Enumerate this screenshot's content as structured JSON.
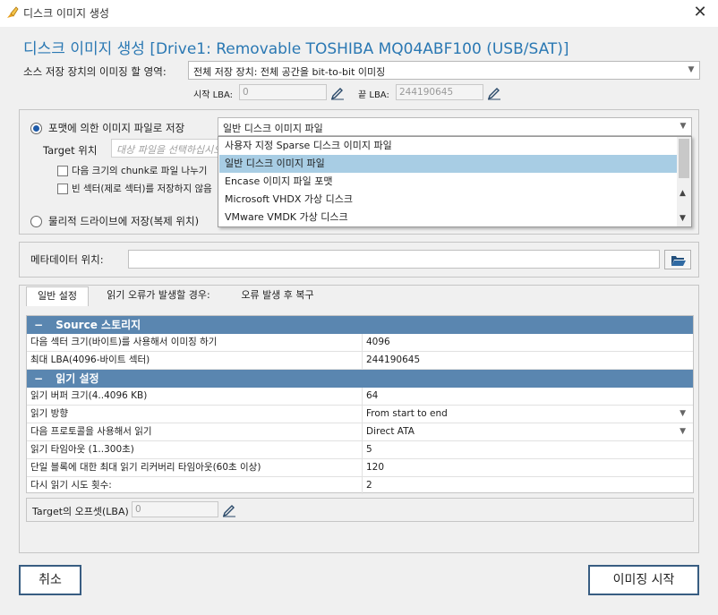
{
  "window": {
    "title": "디스크 이미지 생성",
    "close_glyph": "✕"
  },
  "heading": "디스크 이미지 생성 [Drive1: Removable TOSHIBA MQ04ABF100 (USB/SAT)]",
  "source": {
    "area_label": "소스 저장 장치의 이미징 할 영역:",
    "area_value": "전체 저장 장치: 전체 공간을 bit-to-bit 이미징",
    "start_lba_label": "시작 LBA:",
    "start_lba_value": "0",
    "end_lba_label": "끝 LBA:",
    "end_lba_value": "244190645"
  },
  "target": {
    "save_file_radio_label": "포맷에 의한 이미지 파일로 저장",
    "format_value": "일반 디스크 이미지 파일",
    "location_label": "Target 위치",
    "location_placeholder": "대상 파일을 선택하십시오",
    "chunk_label": "다음 크기의 chunk로 파일 나누기",
    "empty_sector_label": "빈 섹터(제로 섹터)를 저장하지 않음",
    "physical_radio_label": "물리적 드라이브에 저장(복제 위치)"
  },
  "format_dropdown": {
    "options": [
      "사용자 지정 Sparse 디스크 이미지 파일",
      "일반 디스크 이미지 파일",
      "Encase 이미지 파일 포맷",
      "Microsoft VHDX 가상 디스크",
      "VMware VMDK 가상 디스크"
    ],
    "selected_index": 1
  },
  "metadata": {
    "label": "메타데이터 위치:",
    "value": ""
  },
  "tabs": [
    {
      "label": "일반 설정"
    },
    {
      "label": "읽기 오류가 발생할 경우:"
    },
    {
      "label": "오류 발생 후 복구"
    }
  ],
  "grid": {
    "section1": {
      "toggle": "−",
      "title": "Source 스토리지"
    },
    "section1_rows": [
      {
        "key": "다음 섹터 크기(바이트)를 사용해서 이미징 하기",
        "value": "4096"
      },
      {
        "key": "최대 LBA(4096-바이트 섹터)",
        "value": "244190645"
      }
    ],
    "section2": {
      "toggle": "−",
      "title": "읽기 설정"
    },
    "section2_rows": [
      {
        "key": "읽기 버퍼 크기(4..4096 KB)",
        "value": "64"
      },
      {
        "key": "읽기 방향",
        "value": "From start to end"
      },
      {
        "key": "다음 프로토콜을 사용해서 읽기",
        "value": "Direct ATA"
      },
      {
        "key": "읽기 타임아웃 (1..300초)",
        "value": "5"
      },
      {
        "key": "단일 블록에 대한 최대 읽기 리커버리 타임아웃(60초 이상)",
        "value": "120"
      },
      {
        "key": "다시 읽기 시도 횟수:",
        "value": "2"
      }
    ]
  },
  "offset": {
    "label": "Target의 오프셋(LBA)",
    "value": "0"
  },
  "buttons": {
    "cancel": "취소",
    "start": "이미징 시작"
  },
  "colors": {
    "accent": "#2a78b3",
    "section_header": "#5a86b0",
    "selection": "#a8cde4",
    "button_border": "#385d82"
  }
}
